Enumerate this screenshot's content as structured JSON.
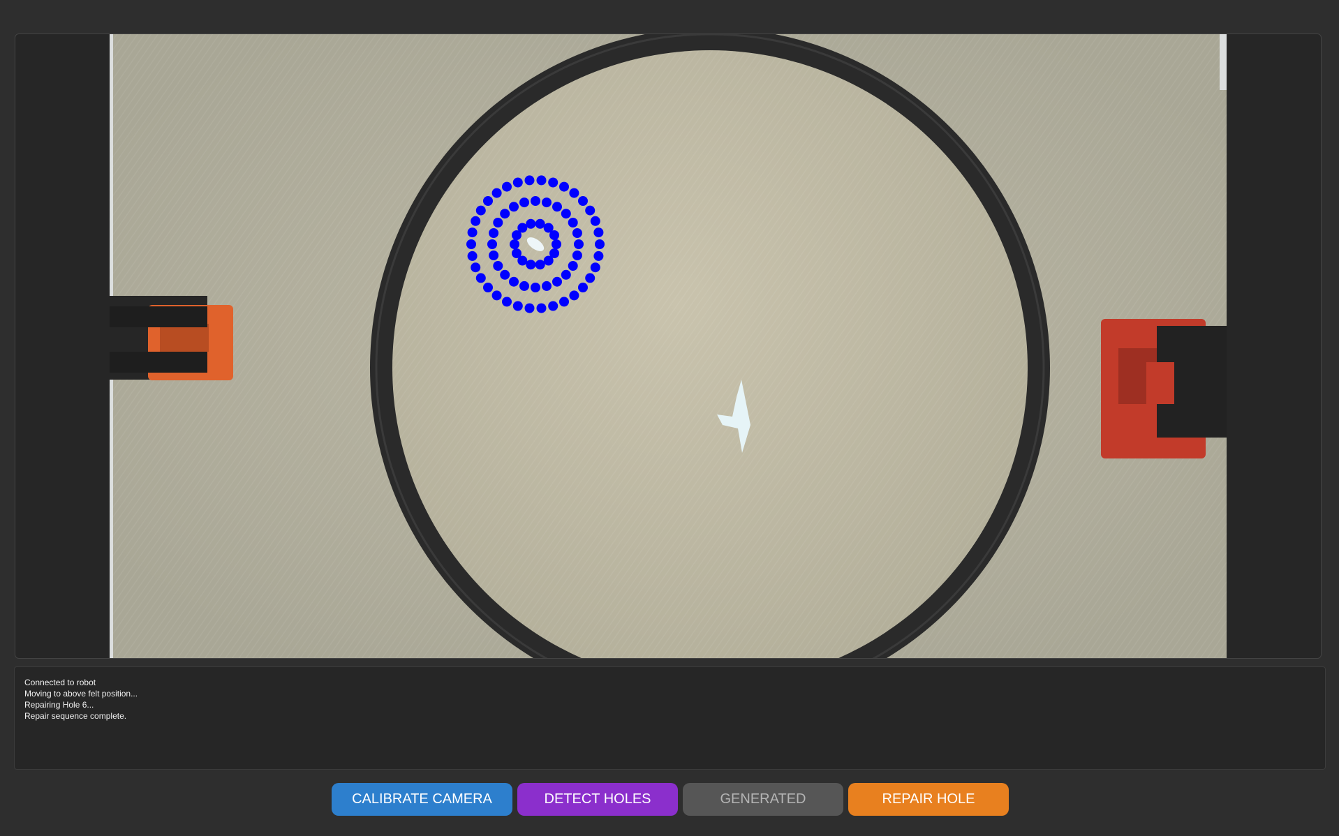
{
  "log": {
    "lines": [
      "Connected to robot",
      "Moving to above felt position...",
      "Repairing Hole 6...",
      "Repair sequence complete."
    ]
  },
  "buttons": {
    "calibrate_label": "CALIBRATE CAMERA",
    "detect_label": "DETECT HOLES",
    "generated_label": "GENERATED",
    "repair_label": "REPAIR HOLE"
  },
  "colors": {
    "background": "#2e2e2e",
    "panel": "#262626",
    "calibrate": "#2d7fcd",
    "detect": "#8b2fcc",
    "generated": "#565656",
    "repair": "#e8801f",
    "spiral_dots": "#0000ff"
  }
}
